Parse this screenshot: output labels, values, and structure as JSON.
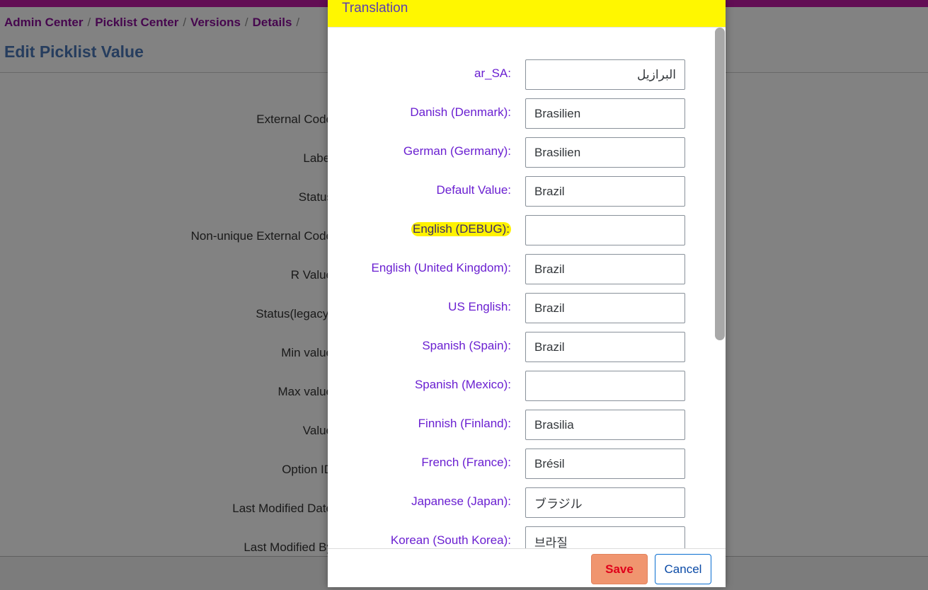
{
  "breadcrumb": {
    "items": [
      "Admin Center",
      "Picklist Center",
      "Versions",
      "Details"
    ],
    "separator": "/"
  },
  "page": {
    "title": "Edit Picklist Value"
  },
  "form": {
    "labels": [
      "External Code",
      "Label",
      "Status",
      "Non-unique External Code",
      "R Value",
      "Status(legacy)",
      "Min value",
      "Max value",
      "Value",
      "Option ID",
      "Last Modified Date",
      "Last Modified By"
    ]
  },
  "dialog": {
    "title": "Translation",
    "rows": [
      {
        "label": "ar_SA:",
        "value": "البرازيل"
      },
      {
        "label": "Danish (Denmark):",
        "value": "Brasilien"
      },
      {
        "label": "German (Germany):",
        "value": "Brasilien"
      },
      {
        "label": "Default Value:",
        "value": "Brazil"
      },
      {
        "label": "English (DEBUG):",
        "value": ""
      },
      {
        "label": "English (United Kingdom):",
        "value": "Brazil"
      },
      {
        "label": "US English:",
        "value": "Brazil"
      },
      {
        "label": "Spanish (Spain):",
        "value": "Brazil"
      },
      {
        "label": "Spanish (Mexico):",
        "value": ""
      },
      {
        "label": "Finnish (Finland):",
        "value": "Brasilia"
      },
      {
        "label": "French (France):",
        "value": "Brésil"
      },
      {
        "label": "Japanese (Japan):",
        "value": "ブラジル"
      },
      {
        "label": "Korean (South Korea):",
        "value": "브라질"
      }
    ],
    "save_label": "Save",
    "cancel_label": "Cancel"
  },
  "colors": {
    "top_strip": "#c01aa6",
    "dialog_header": "#fff700",
    "label_text": "#6a1fd1",
    "save_button": "#f0956f",
    "cancel_border": "#0a6ed1"
  }
}
